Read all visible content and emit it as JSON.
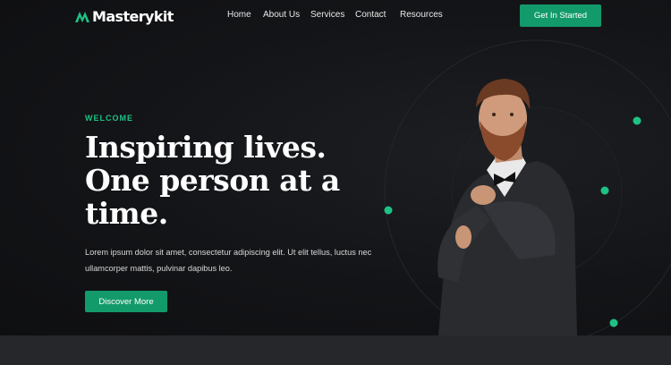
{
  "brand": {
    "name": "Masterykit",
    "accent": "#139a6b",
    "accent_light": "#1fc285"
  },
  "nav": {
    "items": [
      "Home",
      "About Us",
      "Services",
      "Contact",
      "Resources"
    ],
    "cta_label": "Get In Started"
  },
  "hero": {
    "eyebrow": "WELCOME",
    "headline_line1": "Inspiring lives.",
    "headline_line2": "One person at a",
    "headline_line3": "time.",
    "subtitle": "Lorem ipsum dolor sit amet, consectetur adipiscing elit. Ut elit tellus, luctus nec ullamcorper mattis, pulvinar dapibus leo.",
    "cta_label": "Discover More",
    "image": "man-in-suit-portrait"
  }
}
